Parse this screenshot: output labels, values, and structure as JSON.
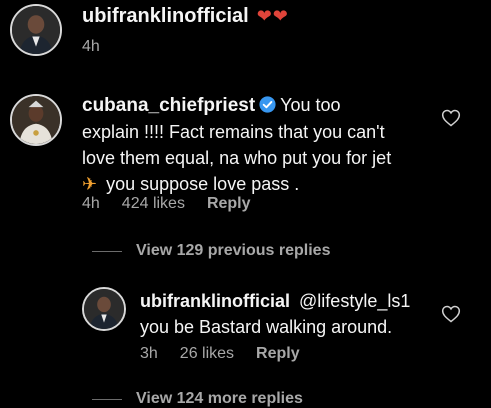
{
  "top_comment": {
    "username": "ubifranklinofficial",
    "emoji": "❤❤",
    "time": "4h"
  },
  "main_comment": {
    "username": "cubana_chiefpriest",
    "text_line1": "You too",
    "text_line2": "explain !!!! Fact remains that you can't",
    "text_line3": "love them equal, na who put you for jet",
    "text_line4_emoji": "✈",
    "text_line4": "you suppose love pass .",
    "time": "4h",
    "likes": "424 likes",
    "reply_label": "Reply"
  },
  "view_previous": "View 129 previous replies",
  "reply_comment": {
    "username": "ubifranklinofficial",
    "mention": "@lifestyle_ls1",
    "text_line2": "you be Bastard walking around.",
    "time": "3h",
    "likes": "26 likes",
    "reply_label": "Reply"
  },
  "view_more": "View 124 more replies",
  "colors": {
    "background": "#000000",
    "text": "#f5f5f5",
    "muted": "#a8a8a8",
    "verified": "#3897f0",
    "heart_emoji": "#e0443a"
  }
}
